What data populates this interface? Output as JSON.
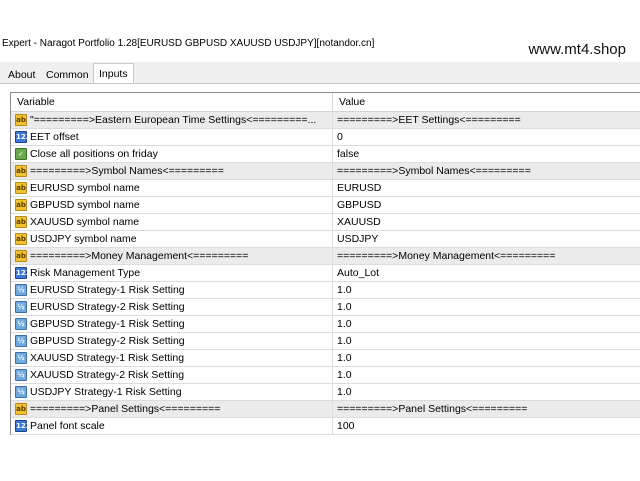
{
  "window": {
    "title": "Expert - Naragot Portfolio 1.28[EURUSD GBPUSD XAUUSD USDJPY][notandor.cn]",
    "watermark": "www.mt4.shop"
  },
  "tabs": [
    {
      "label": "About"
    },
    {
      "label": "Common"
    },
    {
      "label": "Inputs"
    }
  ],
  "active_tab": "Inputs",
  "table": {
    "headers": {
      "variable": "Variable",
      "value": "Value"
    },
    "rows": [
      {
        "icon": "ab",
        "variable": "\"=========>Eastern European Time Settings<=========...",
        "value": "=========>EET Settings<=========",
        "separator": true
      },
      {
        "icon": "num",
        "variable": "EET offset",
        "value": "0"
      },
      {
        "icon": "bool",
        "variable": "Close all positions on friday",
        "value": "false"
      },
      {
        "icon": "ab",
        "variable": "=========>Symbol Names<=========",
        "value": "=========>Symbol Names<=========",
        "separator": true
      },
      {
        "icon": "ab",
        "variable": "EURUSD symbol name",
        "value": "EURUSD"
      },
      {
        "icon": "ab",
        "variable": "GBPUSD symbol name",
        "value": "GBPUSD"
      },
      {
        "icon": "ab",
        "variable": "XAUUSD symbol name",
        "value": "XAUUSD"
      },
      {
        "icon": "ab",
        "variable": "USDJPY symbol name",
        "value": "USDJPY"
      },
      {
        "icon": "ab",
        "variable": "=========>Money Management<=========",
        "value": "=========>Money Management<=========",
        "separator": true
      },
      {
        "icon": "num",
        "variable": "Risk Management Type",
        "value": "Auto_Lot"
      },
      {
        "icon": "frac",
        "variable": "EURUSD Strategy-1 Risk Setting",
        "value": "1.0"
      },
      {
        "icon": "frac",
        "variable": "EURUSD Strategy-2 Risk Setting",
        "value": "1.0"
      },
      {
        "icon": "frac",
        "variable": "GBPUSD Strategy-1 Risk Setting",
        "value": "1.0"
      },
      {
        "icon": "frac",
        "variable": "GBPUSD Strategy-2 Risk Setting",
        "value": "1.0"
      },
      {
        "icon": "frac",
        "variable": "XAUUSD Strategy-1 Risk Setting",
        "value": "1.0"
      },
      {
        "icon": "frac",
        "variable": "XAUUSD Strategy-2 Risk Setting",
        "value": "1.0"
      },
      {
        "icon": "frac",
        "variable": "USDJPY Strategy-1 Risk Setting",
        "value": "1.0"
      },
      {
        "icon": "ab",
        "variable": "=========>Panel Settings<=========",
        "value": "=========>Panel Settings<=========",
        "separator": true
      },
      {
        "icon": "num",
        "variable": "Panel font scale",
        "value": "100"
      }
    ]
  },
  "icons": {
    "ab": {
      "name": "string-type-icon",
      "glyph": "ab"
    },
    "num": {
      "name": "integer-type-icon",
      "glyph": "123"
    },
    "frac": {
      "name": "double-type-icon",
      "glyph": "½"
    },
    "bool": {
      "name": "bool-type-icon",
      "glyph": "✓"
    }
  }
}
